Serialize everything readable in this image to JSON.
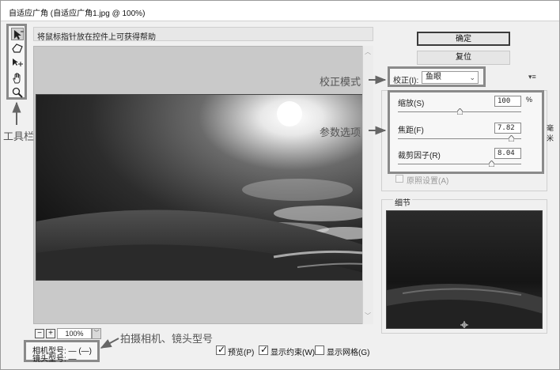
{
  "window": {
    "title": "自适应广角 (自适应广角1.jpg @ 100%)"
  },
  "hint": "将鼠标指针放在控件上可获得帮助",
  "tools": [
    {
      "name": "constraint-tool"
    },
    {
      "name": "polygon-constraint-tool"
    },
    {
      "name": "move-tool"
    },
    {
      "name": "hand-tool"
    },
    {
      "name": "zoom-tool"
    }
  ],
  "zoom": {
    "minus": "−",
    "plus": "+",
    "value": "100%",
    "dropdown": "﹀"
  },
  "camera": {
    "camera_model": "相机型号: — (—)",
    "lens_model": "镜头型号: —"
  },
  "options": {
    "preview": "预览(P)",
    "preview_checked": true,
    "show_constraints": "显示约束(W)",
    "show_constraints_checked": true,
    "show_grid": "显示网格(G)",
    "show_grid_checked": false
  },
  "buttons": {
    "ok": "确定",
    "reset": "复位"
  },
  "correction": {
    "label": "校正(I):",
    "value": "鱼眼",
    "menu_icon": "▾≡"
  },
  "params": {
    "scale": {
      "label": "缩放(S)",
      "value": "100",
      "unit": "%",
      "slider": 0.5
    },
    "focal": {
      "label": "焦距(F)",
      "value": "7.82",
      "unit": "毫米",
      "slider": 0.92
    },
    "crop": {
      "label": "裁剪因子(R)",
      "value": "8.04",
      "slider": 0.76
    }
  },
  "as_shot": "原照设置(A)",
  "detail": {
    "title": "细节"
  },
  "annotations": {
    "toolbar": "工具栏",
    "correction_mode": "校正模式",
    "params": "参数选项",
    "camera": "拍摄相机、镜头型号"
  }
}
